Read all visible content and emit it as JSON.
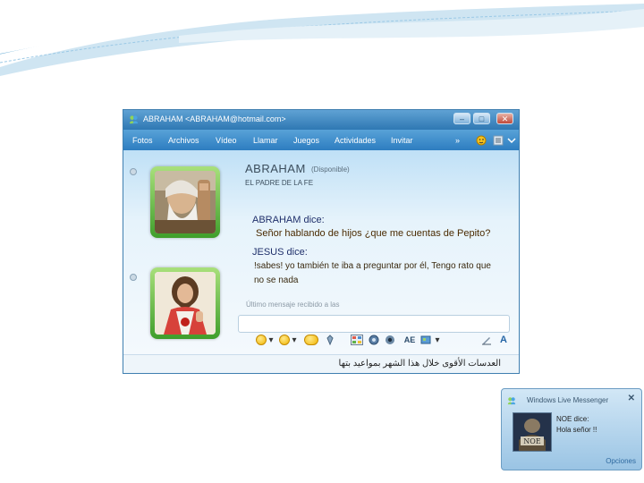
{
  "window": {
    "title": "ABRAHAM <ABRAHAM@hotmail.com>",
    "controls": {
      "minimize": "–",
      "maximize": "□",
      "close": "✕"
    }
  },
  "menubar": {
    "items": [
      "Fotos",
      "Archivos",
      "Vídeo",
      "Llamar",
      "Juegos",
      "Actividades",
      "Invitar"
    ],
    "more": "»"
  },
  "contact": {
    "name": "ABRAHAM",
    "status": "(Disponible)",
    "personal_message": "EL PADRE DE LA FE"
  },
  "conversation": [
    {
      "sender": "ABRAHAM dice:",
      "text": "Señor hablando de hijos ¿que me cuentas de Pepito?"
    },
    {
      "sender": "JESUS dice:",
      "text": "!sabes! yo también te iba a preguntar por él, Tengo rato que no se nada"
    }
  ],
  "last_message_label": "Último mensaje recibido a las",
  "statusbar": {
    "ad": "العدسات الأقوى خلال هذا الشهر بمواعيد بتها"
  },
  "icons": {
    "window": "messenger-icon",
    "menu_extra": [
      "winks-icon",
      "options-icon",
      "menu-icon"
    ],
    "emote_bar": [
      "smile-icon",
      "wink-icon",
      "nudge-icon",
      "voice-clip-icon",
      "background-icon",
      "games-icon",
      "font-icon",
      "block-icon",
      "pen-icon",
      "text-format-icon"
    ]
  },
  "popup": {
    "title": "Windows Live Messenger",
    "close": "✕",
    "from": "NOE dice:",
    "text": "Hola señor !!",
    "options": "Opciones",
    "avatar_caption": "NOE"
  },
  "colors": {
    "titlebar": "#2f78b3",
    "menubar": "#2d7dc0",
    "avatar_frame": "#3f9e2c",
    "message_head": "#1f2f6b"
  }
}
